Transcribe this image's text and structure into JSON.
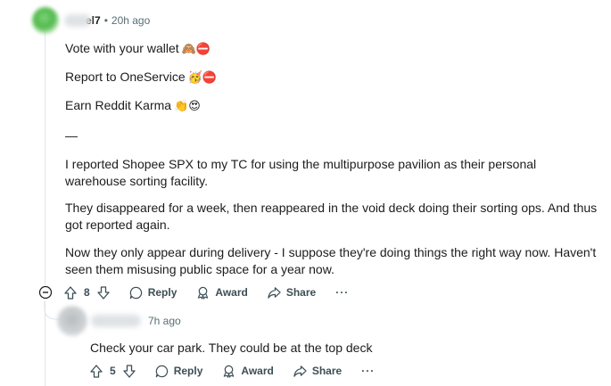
{
  "top_comment": {
    "username_visible": "el7",
    "separator": "•",
    "timestamp": "20h ago",
    "paragraphs": [
      {
        "text": "Vote with your wallet",
        "emojis": "🙈⛔"
      },
      {
        "text": "Report to OneService",
        "emojis": "🥳⛔"
      },
      {
        "text": "Earn Reddit Karma",
        "emojis": "👏😍"
      },
      {
        "text": "—",
        "emojis": ""
      },
      {
        "text": "I reported Shopee SPX to my TC for using the multipurpose pavilion as their personal warehouse sorting facility.",
        "emojis": ""
      },
      {
        "text": "They disappeared for a week, then reappeared in the void deck doing their sorting ops. And thus got reported again.",
        "emojis": ""
      },
      {
        "text": "Now they only appear during delivery - I suppose they're doing things the right way now. Haven't seen them misusing public space for a year now.",
        "emojis": ""
      }
    ],
    "actions": {
      "vote_count": "8",
      "reply": "Reply",
      "award": "Award",
      "share": "Share",
      "more": "···"
    }
  },
  "reply_comment": {
    "timestamp": "7h ago",
    "text": "Check your car park. They could be at the top deck",
    "actions": {
      "vote_count": "5",
      "reply": "Reply",
      "award": "Award",
      "share": "Share",
      "more": "···"
    }
  },
  "colors": {
    "text": "#1c1c1c",
    "meta": "#576f76",
    "rail": "#dfe3e6",
    "action": "#3d4e55"
  }
}
